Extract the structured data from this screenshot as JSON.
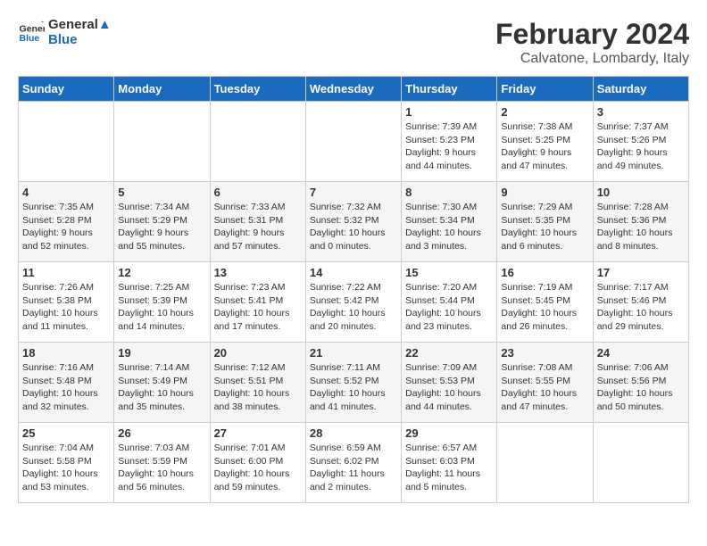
{
  "header": {
    "logo_line1": "General",
    "logo_line2": "Blue",
    "month_title": "February 2024",
    "location": "Calvatone, Lombardy, Italy"
  },
  "days_of_week": [
    "Sunday",
    "Monday",
    "Tuesday",
    "Wednesday",
    "Thursday",
    "Friday",
    "Saturday"
  ],
  "weeks": [
    [
      {
        "day": "",
        "info": ""
      },
      {
        "day": "",
        "info": ""
      },
      {
        "day": "",
        "info": ""
      },
      {
        "day": "",
        "info": ""
      },
      {
        "day": "1",
        "info": "Sunrise: 7:39 AM\nSunset: 5:23 PM\nDaylight: 9 hours\nand 44 minutes."
      },
      {
        "day": "2",
        "info": "Sunrise: 7:38 AM\nSunset: 5:25 PM\nDaylight: 9 hours\nand 47 minutes."
      },
      {
        "day": "3",
        "info": "Sunrise: 7:37 AM\nSunset: 5:26 PM\nDaylight: 9 hours\nand 49 minutes."
      }
    ],
    [
      {
        "day": "4",
        "info": "Sunrise: 7:35 AM\nSunset: 5:28 PM\nDaylight: 9 hours\nand 52 minutes."
      },
      {
        "day": "5",
        "info": "Sunrise: 7:34 AM\nSunset: 5:29 PM\nDaylight: 9 hours\nand 55 minutes."
      },
      {
        "day": "6",
        "info": "Sunrise: 7:33 AM\nSunset: 5:31 PM\nDaylight: 9 hours\nand 57 minutes."
      },
      {
        "day": "7",
        "info": "Sunrise: 7:32 AM\nSunset: 5:32 PM\nDaylight: 10 hours\nand 0 minutes."
      },
      {
        "day": "8",
        "info": "Sunrise: 7:30 AM\nSunset: 5:34 PM\nDaylight: 10 hours\nand 3 minutes."
      },
      {
        "day": "9",
        "info": "Sunrise: 7:29 AM\nSunset: 5:35 PM\nDaylight: 10 hours\nand 6 minutes."
      },
      {
        "day": "10",
        "info": "Sunrise: 7:28 AM\nSunset: 5:36 PM\nDaylight: 10 hours\nand 8 minutes."
      }
    ],
    [
      {
        "day": "11",
        "info": "Sunrise: 7:26 AM\nSunset: 5:38 PM\nDaylight: 10 hours\nand 11 minutes."
      },
      {
        "day": "12",
        "info": "Sunrise: 7:25 AM\nSunset: 5:39 PM\nDaylight: 10 hours\nand 14 minutes."
      },
      {
        "day": "13",
        "info": "Sunrise: 7:23 AM\nSunset: 5:41 PM\nDaylight: 10 hours\nand 17 minutes."
      },
      {
        "day": "14",
        "info": "Sunrise: 7:22 AM\nSunset: 5:42 PM\nDaylight: 10 hours\nand 20 minutes."
      },
      {
        "day": "15",
        "info": "Sunrise: 7:20 AM\nSunset: 5:44 PM\nDaylight: 10 hours\nand 23 minutes."
      },
      {
        "day": "16",
        "info": "Sunrise: 7:19 AM\nSunset: 5:45 PM\nDaylight: 10 hours\nand 26 minutes."
      },
      {
        "day": "17",
        "info": "Sunrise: 7:17 AM\nSunset: 5:46 PM\nDaylight: 10 hours\nand 29 minutes."
      }
    ],
    [
      {
        "day": "18",
        "info": "Sunrise: 7:16 AM\nSunset: 5:48 PM\nDaylight: 10 hours\nand 32 minutes."
      },
      {
        "day": "19",
        "info": "Sunrise: 7:14 AM\nSunset: 5:49 PM\nDaylight: 10 hours\nand 35 minutes."
      },
      {
        "day": "20",
        "info": "Sunrise: 7:12 AM\nSunset: 5:51 PM\nDaylight: 10 hours\nand 38 minutes."
      },
      {
        "day": "21",
        "info": "Sunrise: 7:11 AM\nSunset: 5:52 PM\nDaylight: 10 hours\nand 41 minutes."
      },
      {
        "day": "22",
        "info": "Sunrise: 7:09 AM\nSunset: 5:53 PM\nDaylight: 10 hours\nand 44 minutes."
      },
      {
        "day": "23",
        "info": "Sunrise: 7:08 AM\nSunset: 5:55 PM\nDaylight: 10 hours\nand 47 minutes."
      },
      {
        "day": "24",
        "info": "Sunrise: 7:06 AM\nSunset: 5:56 PM\nDaylight: 10 hours\nand 50 minutes."
      }
    ],
    [
      {
        "day": "25",
        "info": "Sunrise: 7:04 AM\nSunset: 5:58 PM\nDaylight: 10 hours\nand 53 minutes."
      },
      {
        "day": "26",
        "info": "Sunrise: 7:03 AM\nSunset: 5:59 PM\nDaylight: 10 hours\nand 56 minutes."
      },
      {
        "day": "27",
        "info": "Sunrise: 7:01 AM\nSunset: 6:00 PM\nDaylight: 10 hours\nand 59 minutes."
      },
      {
        "day": "28",
        "info": "Sunrise: 6:59 AM\nSunset: 6:02 PM\nDaylight: 11 hours\nand 2 minutes."
      },
      {
        "day": "29",
        "info": "Sunrise: 6:57 AM\nSunset: 6:03 PM\nDaylight: 11 hours\nand 5 minutes."
      },
      {
        "day": "",
        "info": ""
      },
      {
        "day": "",
        "info": ""
      }
    ]
  ]
}
